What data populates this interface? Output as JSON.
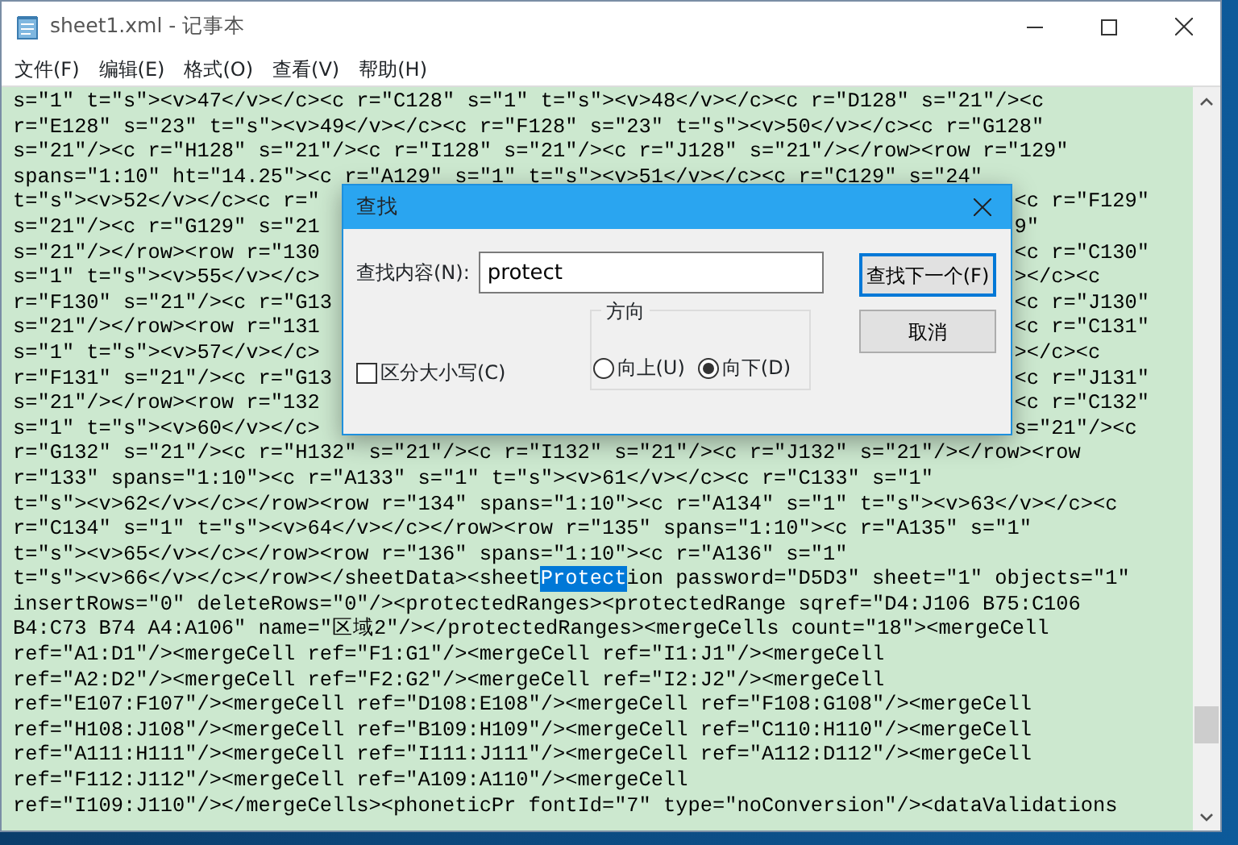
{
  "window": {
    "title": "sheet1.xml - 记事本"
  },
  "menu": [
    "文件(F)",
    "编辑(E)",
    "格式(O)",
    "查看(V)",
    "帮助(H)"
  ],
  "document": {
    "lines": [
      {
        "kind": "full",
        "text": "s=\"1\" t=\"s\"><v>47</v></c><c r=\"C128\" s=\"1\" t=\"s\"><v>48</v></c><c r=\"D128\" s=\"21\"/><c"
      },
      {
        "kind": "full",
        "text": "r=\"E128\" s=\"23\" t=\"s\"><v>49</v></c><c r=\"F128\" s=\"23\" t=\"s\"><v>50</v></c><c r=\"G128\""
      },
      {
        "kind": "full",
        "text": "s=\"21\"/><c r=\"H128\" s=\"21\"/><c r=\"I128\" s=\"21\"/><c r=\"J128\" s=\"21\"/></row><row r=\"129\""
      },
      {
        "kind": "full",
        "text": "spans=\"1:10\" ht=\"14.25\"><c r=\"A129\" s=\"1\" t=\"s\"><v>51</v></c><c r=\"C129\" s=\"24\""
      },
      {
        "kind": "covered",
        "left": "t=\"s\"><v>52</v></c><c r=\"",
        "right": "<c r=\"F129\""
      },
      {
        "kind": "covered",
        "left": "s=\"21\"/><c r=\"G129\" s=\"21",
        "right": "9\""
      },
      {
        "kind": "covered",
        "left": "s=\"21\"/></row><row r=\"130",
        "right": "<c r=\"C130\""
      },
      {
        "kind": "covered",
        "left": "s=\"1\" t=\"s\"><v>55</v></c>",
        "right": "></c><c"
      },
      {
        "kind": "covered",
        "left": "r=\"F130\" s=\"21\"/><c r=\"G13",
        "right": "<c r=\"J130\""
      },
      {
        "kind": "covered",
        "left": "s=\"21\"/></row><row r=\"131",
        "right": "<c r=\"C131\""
      },
      {
        "kind": "covered",
        "left": "s=\"1\" t=\"s\"><v>57</v></c>",
        "right": "></c><c"
      },
      {
        "kind": "covered",
        "left": "r=\"F131\" s=\"21\"/><c r=\"G13",
        "right": "<c r=\"J131\""
      },
      {
        "kind": "covered",
        "left": "s=\"21\"/></row><row r=\"132",
        "right": "<c r=\"C132\""
      },
      {
        "kind": "covered",
        "left": "s=\"1\" t=\"s\"><v>60</v></c>",
        "right": "s=\"21\"/><c"
      },
      {
        "kind": "full",
        "text": "r=\"G132\" s=\"21\"/><c r=\"H132\" s=\"21\"/><c r=\"I132\" s=\"21\"/><c r=\"J132\" s=\"21\"/></row><row"
      },
      {
        "kind": "full",
        "text": "r=\"133\" spans=\"1:10\"><c r=\"A133\" s=\"1\" t=\"s\"><v>61</v></c><c r=\"C133\" s=\"1\""
      },
      {
        "kind": "full",
        "text": "t=\"s\"><v>62</v></c></row><row r=\"134\" spans=\"1:10\"><c r=\"A134\" s=\"1\" t=\"s\"><v>63</v></c><c"
      },
      {
        "kind": "full",
        "text": "r=\"C134\" s=\"1\" t=\"s\"><v>64</v></c></row><row r=\"135\" spans=\"1:10\"><c r=\"A135\" s=\"1\""
      },
      {
        "kind": "full",
        "text": "t=\"s\"><v>65</v></c></row><row r=\"136\" spans=\"1:10\"><c r=\"A136\" s=\"1\""
      },
      {
        "kind": "selection",
        "parts": [
          {
            "text": "t=\"s\"><v>66</v></c></row></sheetData><sheet",
            "selected": false
          },
          {
            "text": "Protect",
            "selected": true
          },
          {
            "text": "ion password=\"D5D3\" sheet=\"1\" objects=\"1\"",
            "selected": false
          }
        ]
      },
      {
        "kind": "full",
        "text": "insertRows=\"0\" deleteRows=\"0\"/><protectedRanges><protectedRange sqref=\"D4:J106 B75:C106"
      },
      {
        "kind": "full",
        "text": "B4:C73 B74 A4:A106\" name=\"区域2\"/></protectedRanges><mergeCells count=\"18\"><mergeCell"
      },
      {
        "kind": "full",
        "text": "ref=\"A1:D1\"/><mergeCell ref=\"F1:G1\"/><mergeCell ref=\"I1:J1\"/><mergeCell"
      },
      {
        "kind": "full",
        "text": "ref=\"A2:D2\"/><mergeCell ref=\"F2:G2\"/><mergeCell ref=\"I2:J2\"/><mergeCell"
      },
      {
        "kind": "full",
        "text": "ref=\"E107:F107\"/><mergeCell ref=\"D108:E108\"/><mergeCell ref=\"F108:G108\"/><mergeCell"
      },
      {
        "kind": "full",
        "text": "ref=\"H108:J108\"/><mergeCell ref=\"B109:H109\"/><mergeCell ref=\"C110:H110\"/><mergeCell"
      },
      {
        "kind": "full",
        "text": "ref=\"A111:H111\"/><mergeCell ref=\"I111:J111\"/><mergeCell ref=\"A112:D112\"/><mergeCell"
      },
      {
        "kind": "full",
        "text": "ref=\"F112:J112\"/><mergeCell ref=\"A109:A110\"/><mergeCell"
      },
      {
        "kind": "full",
        "text": "ref=\"I109:J110\"/></mergeCells><phoneticPr fontId=\"7\" type=\"noConversion\"/><dataValidations"
      }
    ]
  },
  "find_dialog": {
    "title": "查找",
    "find_label": "查找内容(N):",
    "find_value": "protect",
    "match_case": {
      "label": "区分大小写(C)",
      "checked": false
    },
    "direction": {
      "label": "方向",
      "options": [
        {
          "label": "向上(U)",
          "selected": false
        },
        {
          "label": "向下(D)",
          "selected": true
        }
      ]
    },
    "buttons": [
      {
        "label": "查找下一个(F)",
        "default": true
      },
      {
        "label": "取消",
        "default": false
      }
    ]
  }
}
